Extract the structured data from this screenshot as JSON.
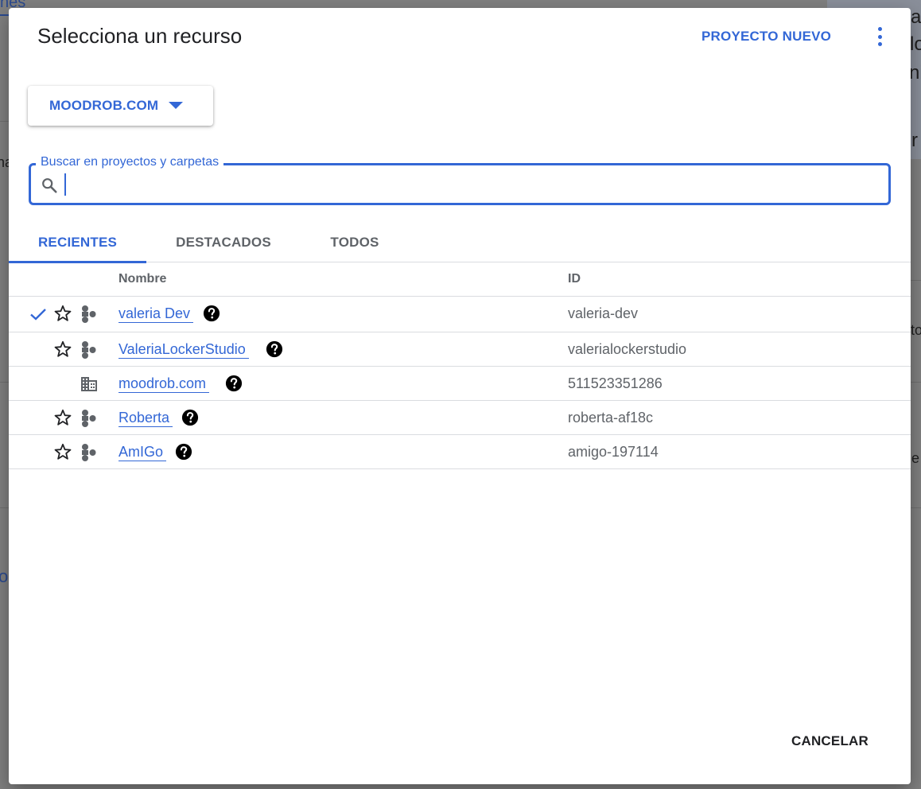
{
  "background": {
    "frag_top_left": "nes",
    "frag_left_1": "na",
    "frag_left_2": "o",
    "frag_right_1": "a",
    "frag_right_2": "lo",
    "frag_right_3": "ni",
    "frag_right_4": "r",
    "frag_right_5": "to",
    "frag_right_6": "e"
  },
  "dialog": {
    "title": "Selecciona un recurso",
    "new_project_label": "PROYECTO NUEVO",
    "org_selector_label": "MOODROB.COM",
    "search": {
      "label": "Buscar en proyectos y carpetas",
      "value": ""
    },
    "tabs": [
      {
        "label": "RECIENTES",
        "active": true
      },
      {
        "label": "DESTACADOS",
        "active": false
      },
      {
        "label": "TODOS",
        "active": false
      }
    ],
    "table": {
      "headers": {
        "name": "Nombre",
        "id": "ID"
      },
      "rows": [
        {
          "name": "valeria Dev",
          "id": "valeria-dev",
          "type": "project-icon",
          "selected": true,
          "starrable": true
        },
        {
          "name": "ValeriaLockerStudio",
          "id": "valerialockerstudio",
          "type": "project-icon",
          "selected": false,
          "starrable": true
        },
        {
          "name": "moodrob.com",
          "id": "511523351286",
          "type": "organization-icon",
          "selected": false,
          "starrable": false
        },
        {
          "name": "Roberta",
          "id": "roberta-af18c",
          "type": "project-icon",
          "selected": false,
          "starrable": true
        },
        {
          "name": "AmIGo",
          "id": "amigo-197114",
          "type": "project-icon",
          "selected": false,
          "starrable": true
        }
      ]
    },
    "cancel_label": "CANCELAR"
  },
  "colors": {
    "accent": "#3367d6",
    "scrim": "#808080",
    "text": "#202124",
    "muted": "#5f6368"
  }
}
